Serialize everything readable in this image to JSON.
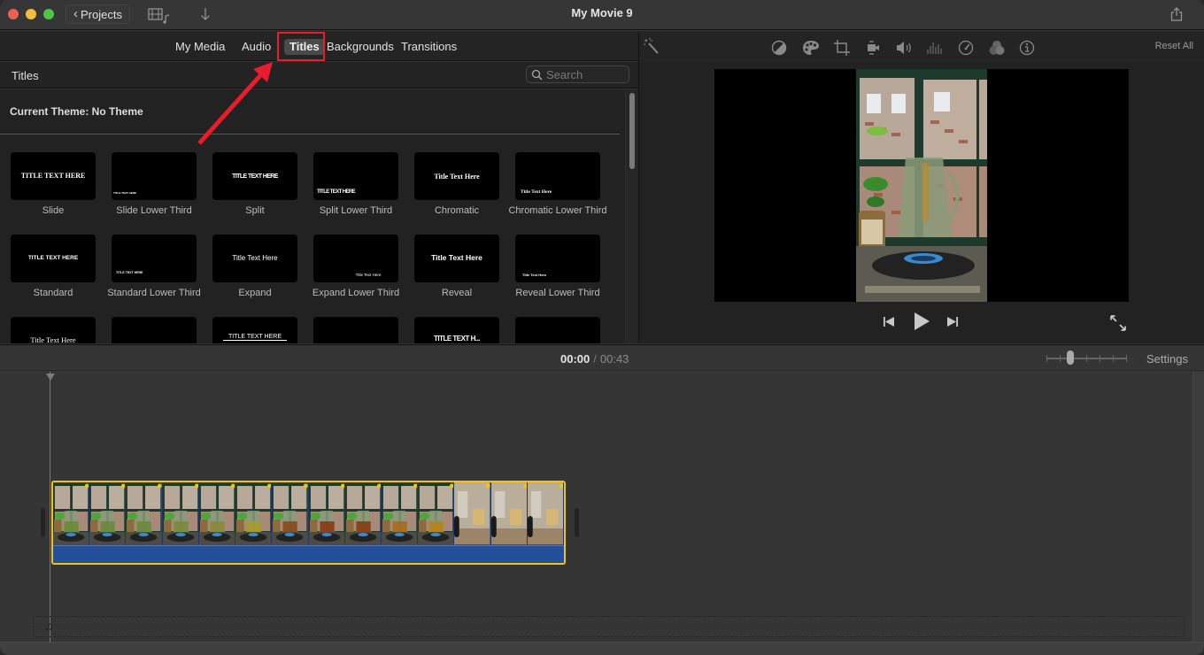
{
  "titlebar": {
    "projects_label": "Projects",
    "window_title": "My Movie 9",
    "icons": [
      "media-browser-icon",
      "import-icon",
      "share-icon"
    ]
  },
  "browser": {
    "tabs": [
      {
        "label": "My Media",
        "active": false
      },
      {
        "label": "Audio",
        "active": false
      },
      {
        "label": "Titles",
        "active": true
      },
      {
        "label": "Backgrounds",
        "active": false
      },
      {
        "label": "Transitions",
        "active": false
      }
    ],
    "section_title": "Titles",
    "search_placeholder": "Search",
    "current_theme": "Current Theme: No Theme",
    "titles": [
      {
        "label": "Slide",
        "preview": "TITLE TEXT HERE"
      },
      {
        "label": "Slide Lower Third",
        "preview": "TITLE TEXT HERE"
      },
      {
        "label": "Split",
        "preview": "TITLE TEXT HERE"
      },
      {
        "label": "Split Lower Third",
        "preview": "TITLE TEXT HERE"
      },
      {
        "label": "Chromatic",
        "preview": "Title Text Here"
      },
      {
        "label": "Chromatic Lower Third",
        "preview": "Title Text Here"
      },
      {
        "label": "Standard",
        "preview": "TITLE TEXT HERE"
      },
      {
        "label": "Standard Lower Third",
        "preview": "TITLE TEXT HERE"
      },
      {
        "label": "Expand",
        "preview": "Title Text Here"
      },
      {
        "label": "Expand Lower Third",
        "preview": "Title Text Here"
      },
      {
        "label": "Reveal",
        "preview": "Title Text Here"
      },
      {
        "label": "Reveal Lower Third",
        "preview": "Title Text Here"
      },
      {
        "label": "",
        "preview": "Title Text Here"
      },
      {
        "label": "",
        "preview": ""
      },
      {
        "label": "",
        "preview": "TITLE TEXT HERE"
      },
      {
        "label": "",
        "preview": ""
      },
      {
        "label": "",
        "preview": "TITLE TEXT H..."
      },
      {
        "label": "",
        "preview": ""
      }
    ]
  },
  "viewer": {
    "tools": [
      "magic-wand-icon",
      "color-balance-icon",
      "color-correction-icon",
      "crop-icon",
      "stabilization-icon",
      "volume-icon",
      "noise-reduction-icon",
      "speed-icon",
      "clip-filter-icon",
      "info-icon"
    ],
    "reset_all": "Reset All"
  },
  "timeline": {
    "current_time": "00:00",
    "separator": "/",
    "total_time": "00:43",
    "settings_label": "Settings",
    "zoom_level": 0.3,
    "clip_frame_count": 14
  },
  "colors": {
    "accent_red": "#e81c2a",
    "clip_border": "#f2c40f",
    "audio_blue": "#24509a"
  }
}
